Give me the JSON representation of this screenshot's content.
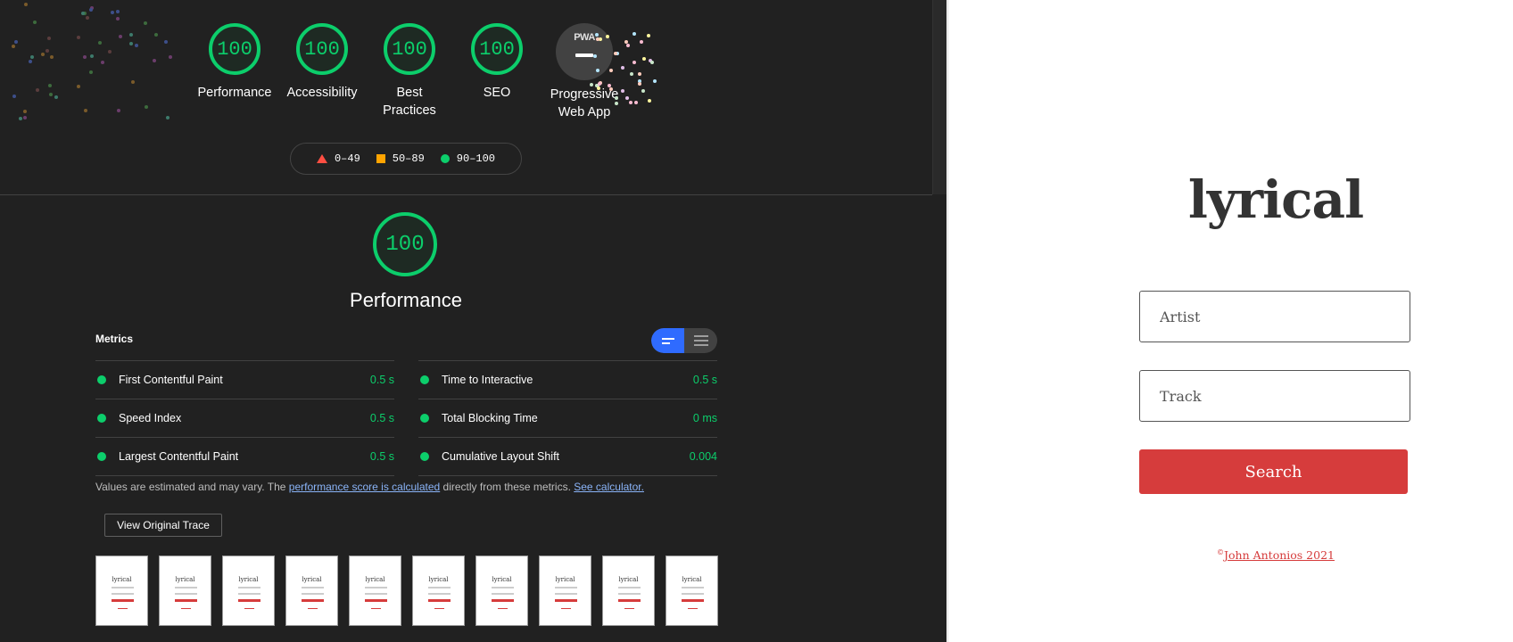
{
  "report": {
    "categories": [
      {
        "score": "100",
        "label": "Performance"
      },
      {
        "score": "100",
        "label": "Accessibility"
      },
      {
        "score": "100",
        "label": "Best Practices"
      },
      {
        "score": "100",
        "label": "SEO"
      }
    ],
    "pwa": {
      "badge": "PWA",
      "label": "Progressive Web App"
    },
    "legend": {
      "fail": "0–49",
      "average": "50–89",
      "pass": "90–100"
    },
    "performance": {
      "score": "100",
      "title": "Performance",
      "metrics_title": "Metrics",
      "metrics_left": [
        {
          "label": "First Contentful Paint",
          "value": "0.5 s"
        },
        {
          "label": "Speed Index",
          "value": "0.5 s"
        },
        {
          "label": "Largest Contentful Paint",
          "value": "0.5 s"
        }
      ],
      "metrics_right": [
        {
          "label": "Time to Interactive",
          "value": "0.5 s"
        },
        {
          "label": "Total Blocking Time",
          "value": "0 ms"
        },
        {
          "label": "Cumulative Layout Shift",
          "value": "0.004"
        }
      ],
      "note_prefix": "Values are estimated and may vary. The ",
      "note_link1": "performance score is calculated",
      "note_middle": " directly from these metrics. ",
      "note_link2": "See calculator.",
      "trace_button": "View Original Trace",
      "filmstrip_title": "lyrical"
    },
    "colors": {
      "pass": "#0cce6b",
      "average": "#ffa400",
      "fail": "#ff4e42",
      "toggle_active": "#2f6bff"
    }
  },
  "app": {
    "logo": "lyrical",
    "artist_placeholder": "Artist",
    "track_placeholder": "Track",
    "search_label": "Search",
    "footer_symbol": "©",
    "footer_link": "John Antonios 2021",
    "colors": {
      "accent": "#d63c3c",
      "text": "#333333"
    }
  }
}
